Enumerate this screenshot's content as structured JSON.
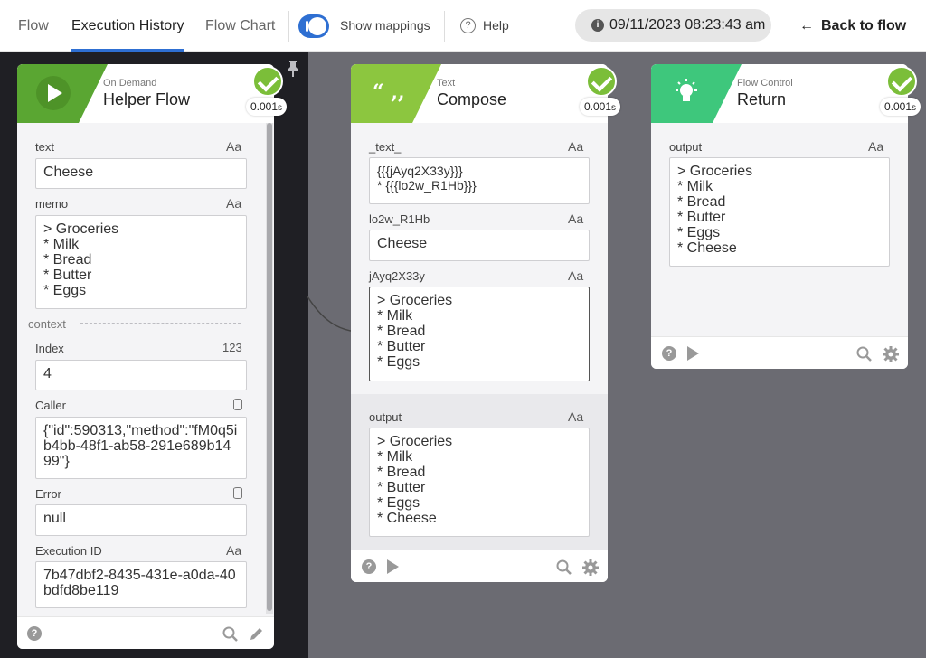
{
  "nav": {
    "tabs": [
      "Flow",
      "Execution History",
      "Flow Chart"
    ],
    "show_mappings": "Show mappings",
    "help": "Help",
    "timestamp": "09/11/2023 08:23:43 am",
    "info_icon": "i",
    "back_arrow": "←",
    "back_label": "Back to flow"
  },
  "colors": {
    "accent": "#2e6fd2",
    "helper_green": "#5aa632",
    "compose_green": "#8cc63f",
    "return_green": "#3ec77c",
    "check": "#7bbe39"
  },
  "cards": {
    "helper": {
      "category": "On Demand",
      "name": "Helper Flow",
      "time": "0.001",
      "time_unit": "s",
      "fields": {
        "text": {
          "label": "text",
          "type": "Aa",
          "value": "Cheese"
        },
        "memo": {
          "label": "memo",
          "type": "Aa",
          "value": "> Groceries\n* Milk\n* Bread\n* Butter\n* Eggs"
        },
        "context_label": "context",
        "index": {
          "label": "Index",
          "type": "123",
          "value": "4"
        },
        "caller": {
          "label": "Caller",
          "value": "{\"id\":590313,\"method\":\"fM0q5i b4bb-48f1-ab58-291e689b1499\"}"
        },
        "error": {
          "label": "Error",
          "value": "null"
        },
        "execution_id": {
          "label": "Execution ID",
          "type": "Aa",
          "value": "7b47dbf2-8435-431e-a0da-40bdfd8be119"
        }
      }
    },
    "compose": {
      "category": "Text",
      "name": "Compose",
      "icon_glyph": "“ ,,",
      "time": "0.001",
      "time_unit": "s",
      "fields": {
        "text_": {
          "label": "_text_",
          "type": "Aa",
          "value": "{{{jAyq2X33y}}}\n* {{{lo2w_R1Hb}}}"
        },
        "lo2w": {
          "label": "lo2w_R1Hb",
          "type": "Aa",
          "value": "Cheese"
        },
        "jayq": {
          "label": "jAyq2X33y",
          "type": "Aa",
          "value": "> Groceries\n* Milk\n* Bread\n* Butter\n* Eggs"
        },
        "output": {
          "label": "output",
          "type": "Aa",
          "value": "> Groceries\n* Milk\n* Bread\n* Butter\n* Eggs\n* Cheese"
        }
      }
    },
    "return": {
      "category": "Flow Control",
      "name": "Return",
      "time": "0.001",
      "time_unit": "s",
      "fields": {
        "output": {
          "label": "output",
          "type": "Aa",
          "value": "> Groceries\n* Milk\n* Bread\n* Butter\n* Eggs\n* Cheese"
        }
      }
    }
  },
  "icons": [
    "pin-icon",
    "play-icon",
    "quote-icon",
    "lightbulb-icon",
    "check-icon",
    "help-icon",
    "search-icon",
    "edit-icon",
    "gear-icon",
    "database-icon"
  ],
  "footer_help_glyph": "?"
}
